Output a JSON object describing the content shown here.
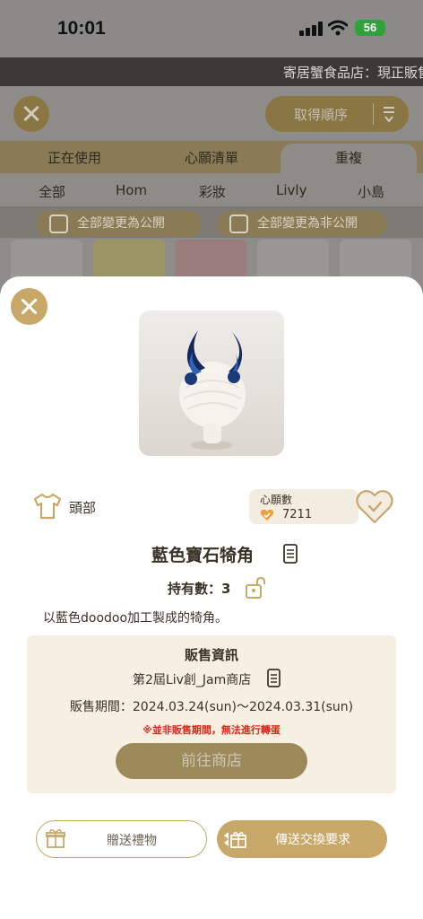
{
  "status_bar": {
    "time": "10:01",
    "battery": "56"
  },
  "background": {
    "marquee": "寄居蟹食品店：現正販售",
    "sort_label": "取得順序",
    "tabs": [
      "正在使用",
      "心願清單",
      "重複"
    ],
    "subtabs": [
      "全部",
      "Hom",
      "彩妝",
      "Livly",
      "小島"
    ],
    "public_all": "全部變更為公開",
    "private_all": "全部變更為非公開"
  },
  "item": {
    "category": "頭部",
    "wish_label": "心願數",
    "wish_count": "7211",
    "name": "藍色寶石犄角",
    "owned": "持有數：3",
    "description": "以藍色doodoo加工製成的犄角。"
  },
  "sale": {
    "title": "販售資訊",
    "shop": "第2屆Liv創_Jam商店",
    "period": "販售期間：2024.03.24(sun)～2024.03.31(sun)",
    "warning": "※並非販售期間，無法進行轉蛋",
    "go_button": "前往商店"
  },
  "actions": {
    "gift": "贈送禮物",
    "trade": "傳送交換要求"
  },
  "colors": {
    "gold": "#c7a868",
    "warning": "#e0251b",
    "sale_bg": "#f7efe2"
  }
}
